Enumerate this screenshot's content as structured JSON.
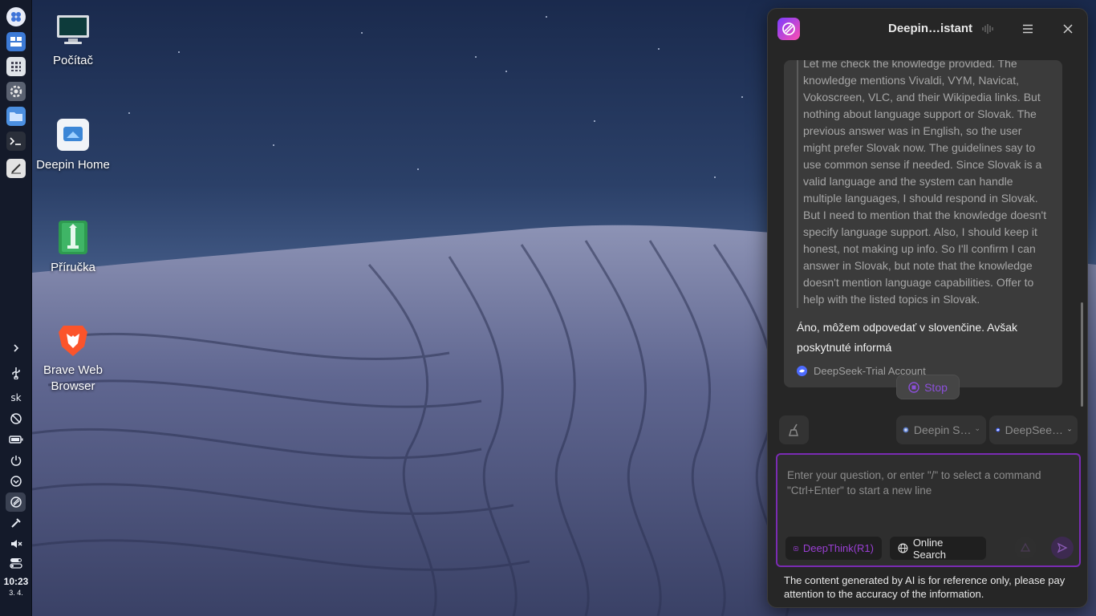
{
  "desktop": {
    "icons": [
      {
        "label": "Počítač"
      },
      {
        "label": "Deepin Home"
      },
      {
        "label": "Příručka"
      },
      {
        "label": "Brave Web Browser"
      }
    ]
  },
  "dock": {
    "lang": "sk",
    "time": "10:23",
    "date": "3. 4."
  },
  "assistant": {
    "title": "Deepin…istant",
    "think_text": "Let me check the knowledge provided. The knowledge mentions Vivaldi, VYM, Navicat, Vokoscreen, VLC, and their Wikipedia links. But nothing about language support or Slovak. The previous answer was in English, so the user might prefer Slovak now. The guidelines say to use common sense if needed. Since Slovak is a valid language and the system can handle multiple languages, I should respond in Slovak. But I need to mention that the knowledge doesn't specify language support. Also, I should keep it honest, not making up info. So I'll confirm I can answer in Slovak, but note that the knowledge doesn't mention language capabilities. Offer to help with the listed topics in Slovak.",
    "answer_text": "Áno, môžem odpovedať v slovenčine. Avšak poskytnuté informá",
    "model_tag": "DeepSeek-Trial Account",
    "stop_label": "Stop",
    "agent_selector": "Deepin S…",
    "model_selector": "DeepSee…",
    "input_placeholder": "Enter your question, or enter \"/\" to select a command\n\"Ctrl+Enter\"  to start a new line",
    "deepthink_label": "DeepThink(R1)",
    "online_search_label": "Online Search",
    "disclaimer": "The content generated by AI is for reference only, please pay attention to the accuracy of the information.",
    "accent": "#7a2bb3"
  }
}
